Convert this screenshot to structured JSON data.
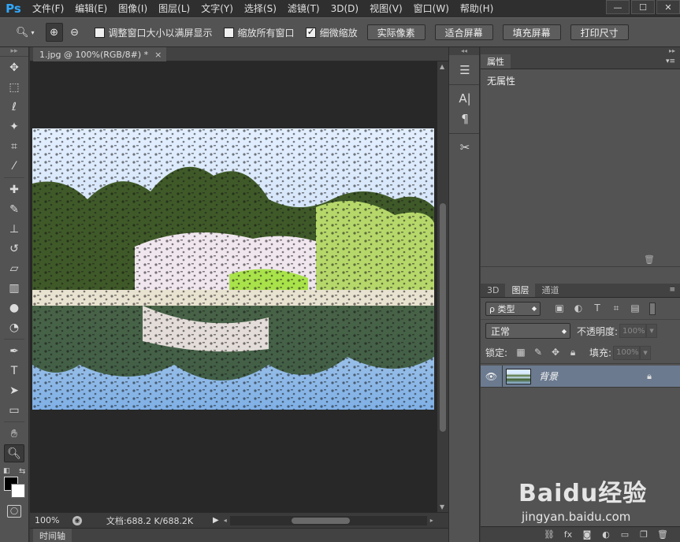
{
  "app": {
    "logo": "Ps"
  },
  "menu": [
    "文件(F)",
    "编辑(E)",
    "图像(I)",
    "图层(L)",
    "文字(Y)",
    "选择(S)",
    "滤镜(T)",
    "3D(D)",
    "视图(V)",
    "窗口(W)",
    "帮助(H)"
  ],
  "window_controls": {
    "minimize": "—",
    "maximize": "☐",
    "close": "✕"
  },
  "options": {
    "tool_icon": "zoom-icon",
    "resize_windows": {
      "label": "调整窗口大小以满屏显示",
      "checked": false
    },
    "zoom_all": {
      "label": "缩放所有窗口",
      "checked": false
    },
    "scrubby_zoom": {
      "label": "细微缩放",
      "checked": true
    },
    "buttons": [
      "实际像素",
      "适合屏幕",
      "填充屏幕",
      "打印尺寸"
    ]
  },
  "document": {
    "tab_title": "1.jpg @ 100%(RGB/8#) *",
    "tab_close": "×",
    "zoom": "100%",
    "doc_size": "文档:688.2 K/688.2K",
    "timeline_tab": "时间轴"
  },
  "properties_panel": {
    "tab": "属性",
    "content": "无属性"
  },
  "layers_panel": {
    "tabs": [
      "3D",
      "图层",
      "通道"
    ],
    "active_tab": "图层",
    "filter_kind": "ρ 类型",
    "blend_mode": "正常",
    "opacity_label": "不透明度:",
    "opacity_value": "100%",
    "lock_label": "锁定:",
    "fill_label": "填充:",
    "fill_value": "100%",
    "layer_name": "背景"
  },
  "watermark": {
    "brand": "Baidu经验",
    "sub": "jingyan.baidu.com"
  },
  "colors": {
    "foreground": "#000000",
    "background": "#ffffff",
    "accent_ps": "#31a8ff",
    "selected_layer": "#6b7a8f"
  }
}
